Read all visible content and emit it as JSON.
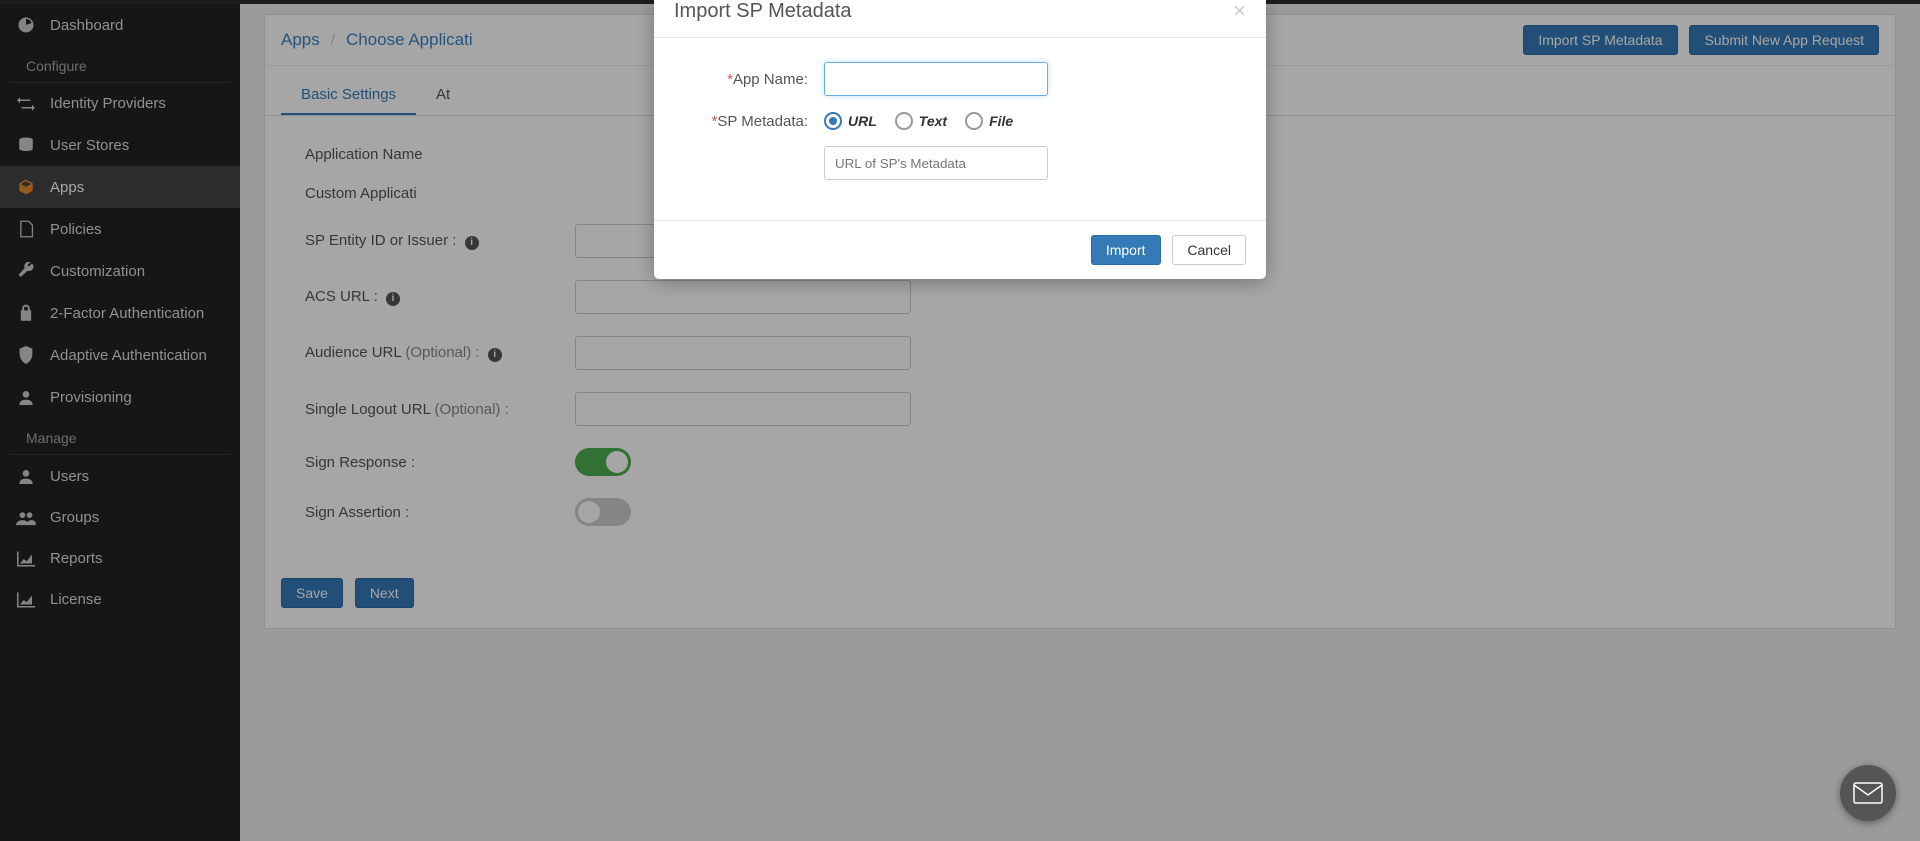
{
  "sidebar": {
    "items": [
      {
        "label": "Dashboard",
        "icon": "dashboard"
      },
      {
        "header": true,
        "label": "Configure"
      },
      {
        "label": "Identity Providers",
        "icon": "exchange"
      },
      {
        "label": "User Stores",
        "icon": "database"
      },
      {
        "label": "Apps",
        "icon": "cube",
        "active": true
      },
      {
        "label": "Policies",
        "icon": "file"
      },
      {
        "label": "Customization",
        "icon": "wrench"
      },
      {
        "label": "2-Factor Authentication",
        "icon": "lock"
      },
      {
        "label": "Adaptive Authentication",
        "icon": "shield"
      },
      {
        "label": "Provisioning",
        "icon": "user"
      },
      {
        "header": true,
        "label": "Manage"
      },
      {
        "label": "Users",
        "icon": "user"
      },
      {
        "label": "Groups",
        "icon": "users"
      },
      {
        "label": "Reports",
        "icon": "chart"
      },
      {
        "label": "License",
        "icon": "chart"
      }
    ]
  },
  "breadcrumb": {
    "root": "Apps",
    "current": "Choose Applicati"
  },
  "header_buttons": {
    "import": "Import SP Metadata",
    "submit": "Submit New App Request"
  },
  "tabs": {
    "basic": "Basic Settings",
    "attr": "At"
  },
  "form": {
    "app_name": "Application Name",
    "custom_app": "Custom Applicati",
    "sp_entity": "SP Entity ID or Issuer :",
    "acs_url": "ACS URL :",
    "audience_url": "Audience URL",
    "audience_opt": "(Optional) :",
    "slo_url": "Single Logout URL",
    "slo_opt": "(Optional) :",
    "sign_response": "Sign Response :",
    "sign_assertion": "Sign Assertion :"
  },
  "form_actions": {
    "save": "Save",
    "next": "Next"
  },
  "modal": {
    "title": "Import SP Metadata",
    "app_name_label": "App Name:",
    "sp_metadata_label": "SP Metadata:",
    "radio_url": "URL",
    "radio_text": "Text",
    "radio_file": "File",
    "url_placeholder": "URL of SP's Metadata",
    "import_btn": "Import",
    "cancel_btn": "Cancel"
  }
}
